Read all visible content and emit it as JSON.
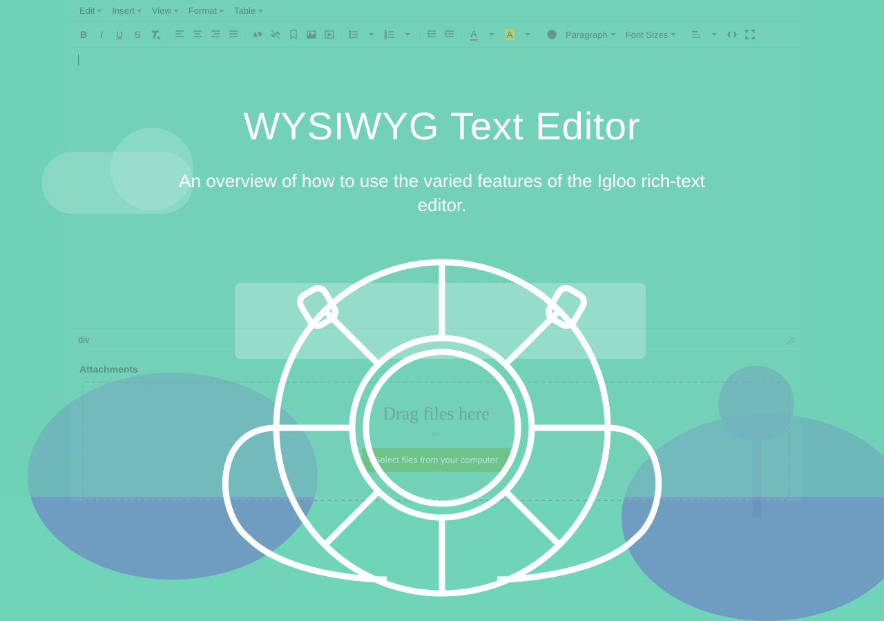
{
  "hero": {
    "title": "WYSIWYG Text Editor",
    "subtitle": "An overview of how to use the varied features of the Igloo rich-text editor."
  },
  "menubar": {
    "edit": "Edit",
    "insert": "Insert",
    "view": "View",
    "format": "Format",
    "table": "Table"
  },
  "toolbar": {
    "bold": "B",
    "italic": "I",
    "underline": "U",
    "strike": "S",
    "paragraph": "Paragraph",
    "fontsizes": "Font Sizes",
    "textcolor": "A",
    "bgcolor": "A"
  },
  "status": {
    "path": "div"
  },
  "attachments": {
    "heading": "Attachments",
    "drag": "Drag files here",
    "or": "- or -",
    "button": "Select files from your computer"
  }
}
